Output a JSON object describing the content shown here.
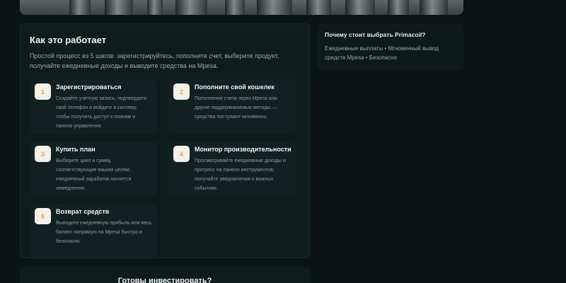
{
  "how_it_works": {
    "title": "Как это работает",
    "description": "Простой процесс из 5 шагов: зарегистрируйтесь, пополните счет, выберите продукт, получайте ежедневные доходы и выводите средства на Mpesa.",
    "steps": [
      {
        "number": "1",
        "title": "Зарегистрироваться",
        "description": "Создайте учетную запись, подтвердите свой телефон и войдите в систему, чтобы получить доступ к планам и панели управления."
      },
      {
        "number": "2",
        "title": "Пополните свой кошелек",
        "description": "Пополнение счета через Mpesa или другие поддерживаемые методы — средства поступают мгновенно."
      },
      {
        "number": "3",
        "title": "Купить план",
        "description": "Выберите цикл и сумму, соответствующие вашим целям; ежедневный заработок начнется немедленно."
      },
      {
        "number": "4",
        "title": "Монитор производительности",
        "description": "Просматривайте ежедневные доходы и прогресс на панели инструментов; получайте уведомления о важных событиях."
      },
      {
        "number": "5",
        "title": "Возврат средств",
        "description": "Выводите ежедневную прибыль или весь баланс напрямую на Mpesa быстро и безопасно."
      }
    ]
  },
  "why_choose": {
    "title": "Почему стоит выбрать Primacoil?",
    "text": "Ежедневные выплаты • Мгновенный вывод средств Mpesa • Безопасно"
  },
  "cta": {
    "title": "Готовы инвестировать?"
  },
  "colors": {
    "background": "#0b1314",
    "panel": "#101b1c",
    "step_card": "#122022",
    "step_number_text": "#e3a53a",
    "step_number_bg": "#f4f1ea"
  }
}
